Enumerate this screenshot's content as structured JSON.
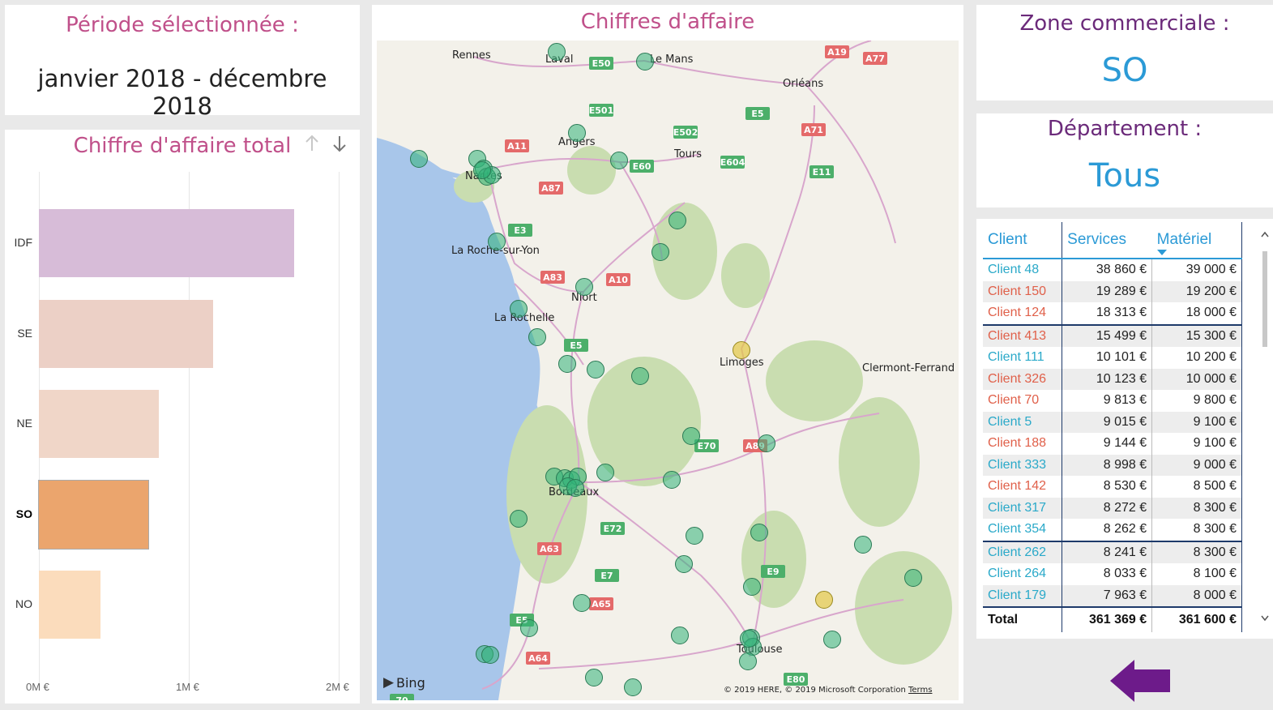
{
  "period": {
    "title": "Période sélectionnée :",
    "value": "janvier 2018 - décembre 2018"
  },
  "map": {
    "title": "Chiffres d'affaire",
    "attribution": "© 2019 HERE, © 2019 Microsoft Corporation",
    "terms": "Terms",
    "logo": "Bing",
    "cities": [
      "Rennes",
      "Laval",
      "Le Mans",
      "Orléans",
      "Angers",
      "Tours",
      "Nantes",
      "La Roche-sur-Yon",
      "Niort",
      "La Rochelle",
      "Limoges",
      "Clermont-Ferrand",
      "Bordeaux",
      "Toulouse"
    ],
    "roads": [
      "A19",
      "A77",
      "E50",
      "E501",
      "E5",
      "A71",
      "E502",
      "A11",
      "E60",
      "E604",
      "E11",
      "A87",
      "E3",
      "A83",
      "A10",
      "E5",
      "E70",
      "A89",
      "E72",
      "A63",
      "E7",
      "E9",
      "A65",
      "E5",
      "A64",
      "E80",
      "70"
    ]
  },
  "chart_data": {
    "type": "bar",
    "title": "Chiffre d'affaire total",
    "categories": [
      "IDF",
      "SE",
      "NE",
      "SO",
      "NO"
    ],
    "values": [
      1.7,
      1.16,
      0.8,
      0.73,
      0.41
    ],
    "selected": "SO",
    "xlim": [
      0,
      2
    ],
    "ticks": [
      "0M €",
      "1M €",
      "2M €"
    ],
    "colors": [
      "#d7bcd8",
      "#ecd0c6",
      "#f0d6c8",
      "#eba56d",
      "#fbdcbc"
    ]
  },
  "zone": {
    "title": "Zone commerciale :",
    "value": "SO"
  },
  "department": {
    "title": "Département :",
    "value": "Tous"
  },
  "table": {
    "headers": [
      "Client",
      "Services",
      "Matériel"
    ],
    "rows": [
      {
        "client": "Client 48",
        "services": "38 860 €",
        "materiel": "39 000 €",
        "color": "#2aa9c9"
      },
      {
        "client": "Client 150",
        "services": "19 289 €",
        "materiel": "19 200 €",
        "color": "#e0604a"
      },
      {
        "client": "Client 124",
        "services": "18 313 €",
        "materiel": "18 000 €",
        "color": "#e0604a"
      },
      {
        "client": "Client 413",
        "services": "15 499 €",
        "materiel": "15 300 €",
        "color": "#e0604a"
      },
      {
        "client": "Client 111",
        "services": "10 101 €",
        "materiel": "10 200 €",
        "color": "#2aa9c9"
      },
      {
        "client": "Client 326",
        "services": "10 123 €",
        "materiel": "10 000 €",
        "color": "#e0604a"
      },
      {
        "client": "Client 70",
        "services": "9 813 €",
        "materiel": "9 800 €",
        "color": "#e0604a"
      },
      {
        "client": "Client 5",
        "services": "9 015 €",
        "materiel": "9 100 €",
        "color": "#2aa9c9"
      },
      {
        "client": "Client 188",
        "services": "9 144 €",
        "materiel": "9 100 €",
        "color": "#e0604a"
      },
      {
        "client": "Client 333",
        "services": "8 998 €",
        "materiel": "9 000 €",
        "color": "#2aa9c9"
      },
      {
        "client": "Client 142",
        "services": "8 530 €",
        "materiel": "8 500 €",
        "color": "#e0604a"
      },
      {
        "client": "Client 317",
        "services": "8 272 €",
        "materiel": "8 300 €",
        "color": "#2aa9c9"
      },
      {
        "client": "Client 354",
        "services": "8 262 €",
        "materiel": "8 300 €",
        "color": "#2aa9c9"
      },
      {
        "client": "Client 262",
        "services": "8 241 €",
        "materiel": "8 300 €",
        "color": "#2aa9c9"
      },
      {
        "client": "Client 264",
        "services": "8 033 €",
        "materiel": "8 100 €",
        "color": "#2aa9c9"
      },
      {
        "client": "Client 179",
        "services": "7 963 €",
        "materiel": "8 000 €",
        "color": "#2aa9c9"
      }
    ],
    "total": {
      "label": "Total",
      "services": "361 369 €",
      "materiel": "361 600 €"
    }
  }
}
